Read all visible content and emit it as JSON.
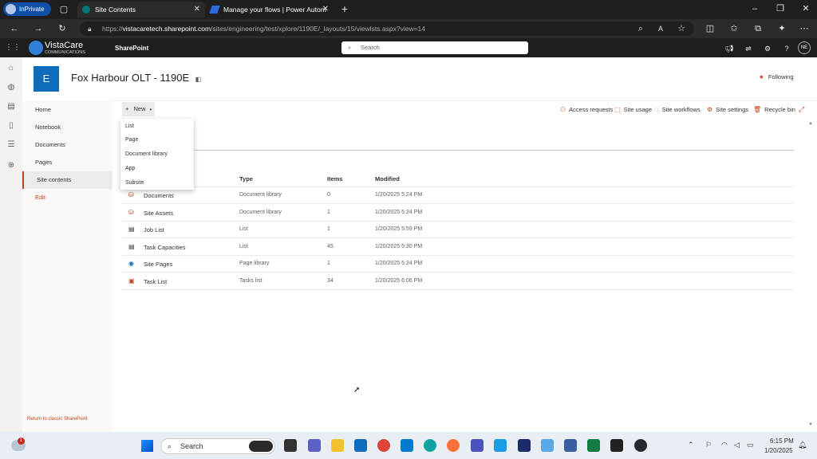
{
  "browser": {
    "profile": "InPrivate",
    "tabs": [
      {
        "title": "Site Contents",
        "active": true
      },
      {
        "title": "Manage your flows | Power Autom",
        "active": false
      }
    ],
    "url_prefix": "https://",
    "url_host": "vistacaretech.sharepoint.com",
    "url_path": "/sites/engineering/test/xplore/1190E/_layouts/15/viewlsts.aspx?view=14"
  },
  "suitebar": {
    "brand_name": "VistaCare",
    "brand_sub": "COMMUNICATIONS",
    "app_name": "SharePoint",
    "search_placeholder": "Search",
    "avatar_initials": "NE"
  },
  "site": {
    "logo_letter": "E",
    "title": "Fox Harbour OLT - 1190E",
    "following_label": "Following"
  },
  "leftnav": {
    "items": [
      "Home",
      "Notebook",
      "Documents",
      "Pages",
      "Site contents"
    ],
    "edit_label": "Edit",
    "classic_link": "Return to classic SharePoint"
  },
  "commandbar": {
    "new_label": "New",
    "actions": [
      "Access requests",
      "Site usage",
      "Site workflows",
      "Site settings",
      "Recycle bin"
    ]
  },
  "new_menu": [
    "List",
    "Page",
    "Document library",
    "App",
    "Subsite"
  ],
  "table": {
    "headers": [
      "Type",
      "Items",
      "Modified"
    ],
    "rows": [
      {
        "name": "Documents",
        "type": "Document library",
        "items": "0",
        "modified": "1/20/2025 5:24 PM"
      },
      {
        "name": "Site Assets",
        "type": "Document library",
        "items": "1",
        "modified": "1/20/2025 5:24 PM"
      },
      {
        "name": "Job List",
        "type": "List",
        "items": "1",
        "modified": "1/20/2025 5:59 PM"
      },
      {
        "name": "Task Capacities",
        "type": "List",
        "items": "45",
        "modified": "1/20/2025 5:30 PM"
      },
      {
        "name": "Site Pages",
        "type": "Page library",
        "items": "1",
        "modified": "1/20/2025 5:24 PM"
      },
      {
        "name": "Task List",
        "type": "Tasks list",
        "items": "34",
        "modified": "1/20/2025 6:06 PM"
      }
    ]
  },
  "taskbar": {
    "search_label": "Search",
    "time": "6:15 PM",
    "date": "1/20/2025",
    "notification_count": "1"
  },
  "colors": {
    "accent": "#c43e1c",
    "site_logo": "#0f6cbd",
    "chrome_dark": "#1f1f1f"
  }
}
